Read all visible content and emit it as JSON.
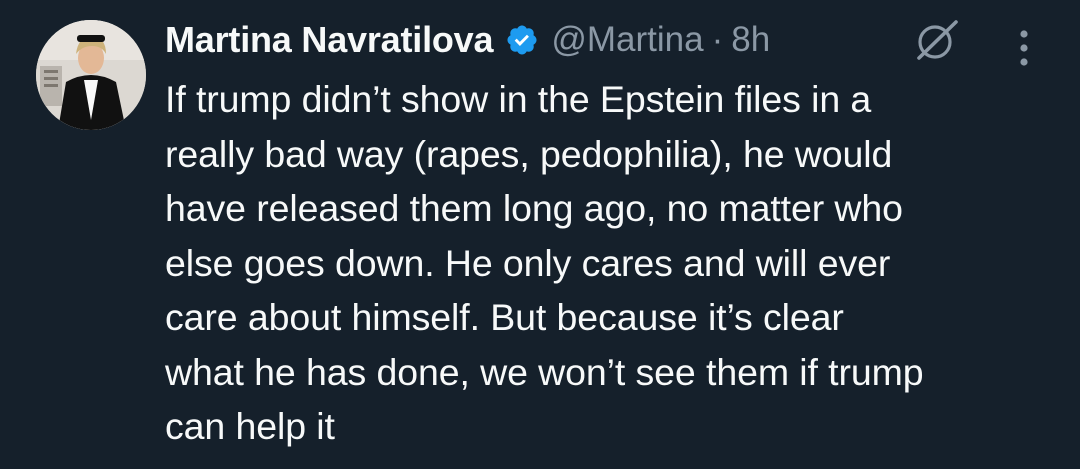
{
  "author": {
    "display_name": "Martina Navratilova",
    "handle": "@Martina",
    "separator": "·",
    "time": "8h",
    "verified": true
  },
  "icons": {
    "verified": "verified-badge-icon",
    "grok": "grok-icon",
    "more": "more-vertical-icon"
  },
  "tweet": {
    "text": "If trump didn’t show in the Epstein files in a\nreally bad way (rapes, pedophilia), he would\nhave released them long ago, no matter who\nelse goes down. He only cares and will ever\ncare about himself. But because it’s clear\nwhat he has done, we won’t see them if trump\ncan help it"
  },
  "colors": {
    "background": "#15202b",
    "text": "#f7f9f9",
    "secondary": "#8b98a5",
    "verified": "#1d9bf0"
  }
}
